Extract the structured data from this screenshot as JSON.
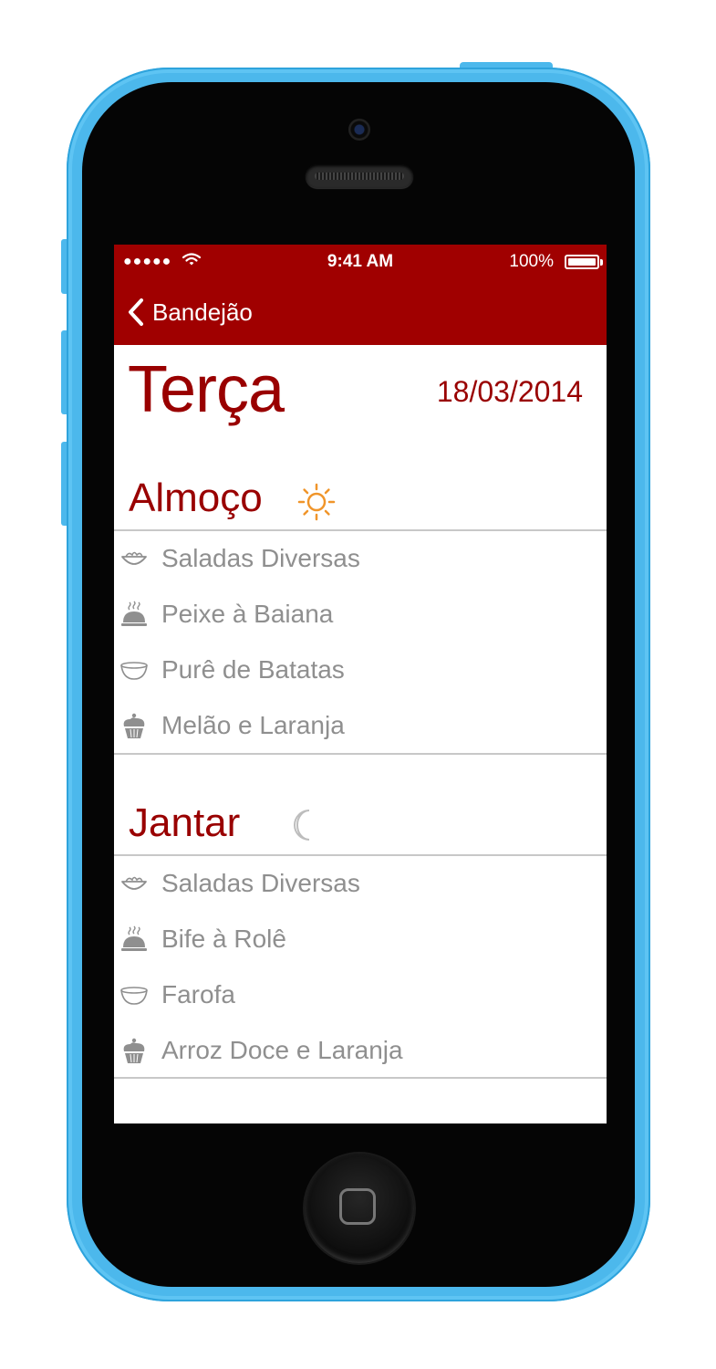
{
  "status_bar": {
    "signal": "●●●●●",
    "time": "9:41 AM",
    "battery": "100%"
  },
  "nav": {
    "back_label": "Bandejão"
  },
  "day": {
    "name": "Terça",
    "date": "18/03/2014"
  },
  "lunch": {
    "title": "Almoço",
    "icon": "sun-icon",
    "items": [
      {
        "label": "Saladas Diversas",
        "icon": "salad-icon"
      },
      {
        "label": "Peixe à Baiana",
        "icon": "cloche-icon"
      },
      {
        "label": "Purê de Batatas",
        "icon": "bowl-icon"
      },
      {
        "label": "Melão e Laranja",
        "icon": "cupcake-icon"
      }
    ]
  },
  "dinner": {
    "title": "Jantar",
    "icon": "moon-icon",
    "items": [
      {
        "label": "Saladas Diversas",
        "icon": "salad-icon"
      },
      {
        "label": "Bife à Rolê",
        "icon": "cloche-icon"
      },
      {
        "label": "Farofa",
        "icon": "bowl-icon"
      },
      {
        "label": "Arroz Doce e Laranja",
        "icon": "cupcake-icon"
      }
    ]
  },
  "colors": {
    "brand": "#a00000",
    "title_text": "#990000",
    "item_text": "#8f8f8f",
    "sun": "#f0952a",
    "device": "#4cb8ec"
  }
}
